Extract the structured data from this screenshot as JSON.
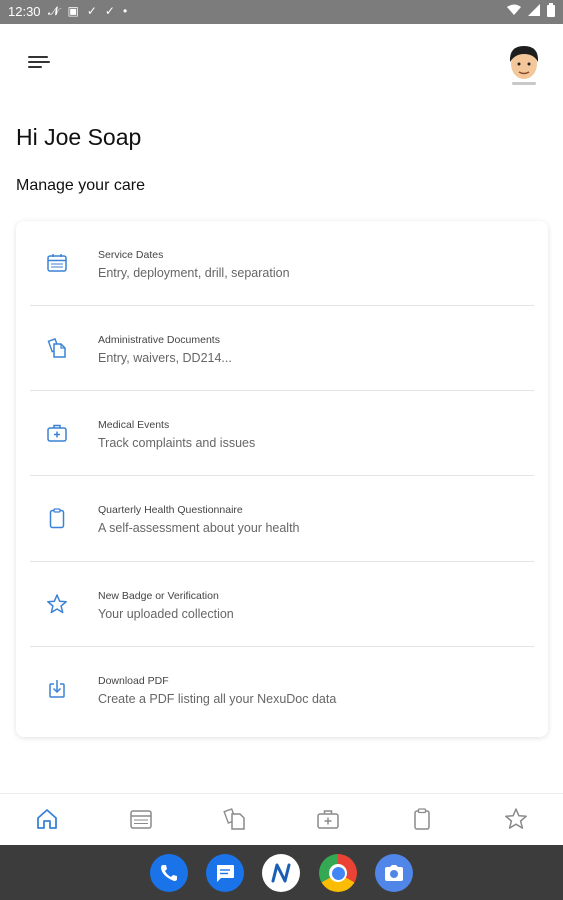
{
  "status_bar": {
    "time": "12:30"
  },
  "greeting": "Hi Joe Soap",
  "section_title": "Manage your care",
  "care_items": [
    {
      "title": "Service Dates",
      "subtitle": "Entry, deployment, drill, separation",
      "icon": "calendar-icon"
    },
    {
      "title": "Administrative Documents",
      "subtitle": "Entry, waivers, DD214...",
      "icon": "documents-icon"
    },
    {
      "title": "Medical Events",
      "subtitle": "Track complaints and issues",
      "icon": "medical-kit-icon"
    },
    {
      "title": "Quarterly Health Questionnaire",
      "subtitle": "A self-assessment about your health",
      "icon": "clipboard-icon"
    },
    {
      "title": "New Badge or Verification",
      "subtitle": "Your uploaded collection",
      "icon": "star-icon"
    },
    {
      "title": "Download PDF",
      "subtitle": "Create a PDF listing all your NexuDoc data",
      "icon": "download-icon"
    }
  ],
  "bottom_nav": [
    "home-icon",
    "calendar-icon",
    "documents-icon",
    "medical-kit-icon",
    "clipboard-icon",
    "star-icon"
  ],
  "dock": [
    "phone-icon",
    "messages-icon",
    "nexudoc-icon",
    "chrome-icon",
    "camera-icon"
  ],
  "colors": {
    "accent": "#3b82d6",
    "icon_gray": "#8a8a8a",
    "status_bar": "#7c7c7c",
    "dock": "#3c3c3c"
  }
}
